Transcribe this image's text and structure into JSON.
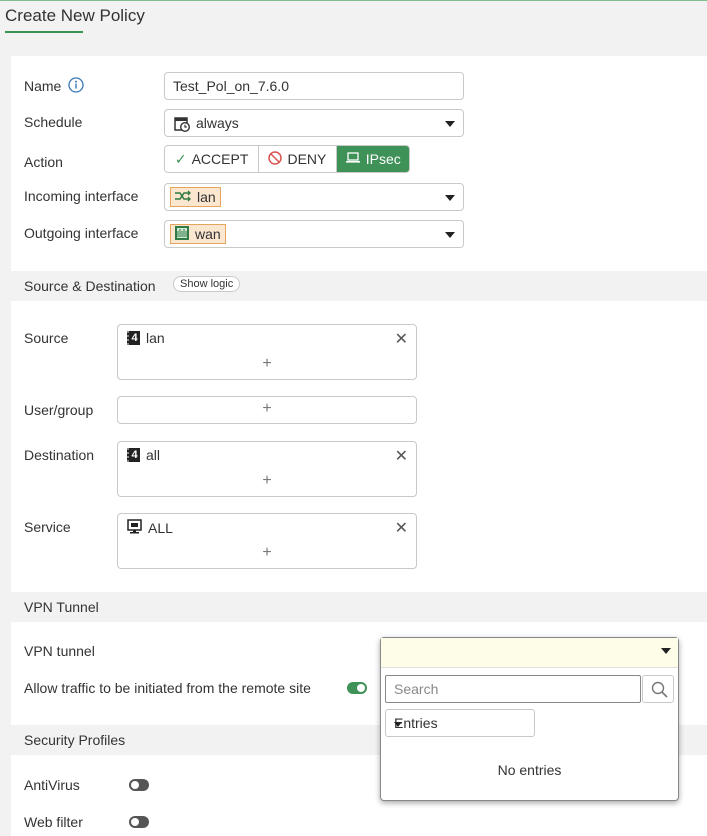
{
  "page_title": "Create New Policy",
  "form": {
    "name": {
      "label": "Name",
      "value": "Test_Pol_on_7.6.0"
    },
    "schedule": {
      "label": "Schedule",
      "value": "always"
    },
    "action": {
      "label": "Action",
      "options": [
        "ACCEPT",
        "DENY",
        "IPsec"
      ],
      "selected": "IPsec"
    },
    "incoming": {
      "label": "Incoming interface",
      "value": "lan"
    },
    "outgoing": {
      "label": "Outgoing interface",
      "value": "wan"
    }
  },
  "source_destination": {
    "title": "Source & Destination",
    "show_logic": "Show logic",
    "source": {
      "label": "Source",
      "value": "lan"
    },
    "user_group": {
      "label": "User/group"
    },
    "destination": {
      "label": "Destination",
      "value": "all"
    },
    "service": {
      "label": "Service",
      "value": "ALL"
    }
  },
  "vpn": {
    "title": "VPN Tunnel",
    "tunnel_label": "VPN tunnel",
    "allow_remote_label": "Allow traffic to be initiated from the remote site",
    "allow_remote_enabled": true
  },
  "dropdown": {
    "search_placeholder": "Search",
    "entries_label": "Entries",
    "empty_text": "No entries"
  },
  "security_profiles": {
    "title": "Security Profiles",
    "antivirus": {
      "label": "AntiVirus",
      "enabled": false
    },
    "web_filter": {
      "label": "Web filter",
      "enabled": false
    }
  },
  "colors": {
    "accent": "#3e9157",
    "chip_bg": "#fbe6cf",
    "chip_border": "#e6a55c"
  },
  "icons": [
    "info-icon",
    "schedule-icon",
    "check-icon",
    "deny-icon",
    "laptop-icon",
    "interface-icon",
    "wan-icon",
    "address-icon",
    "service-icon",
    "close-icon",
    "plus-icon",
    "search-icon",
    "caret-down-icon"
  ]
}
